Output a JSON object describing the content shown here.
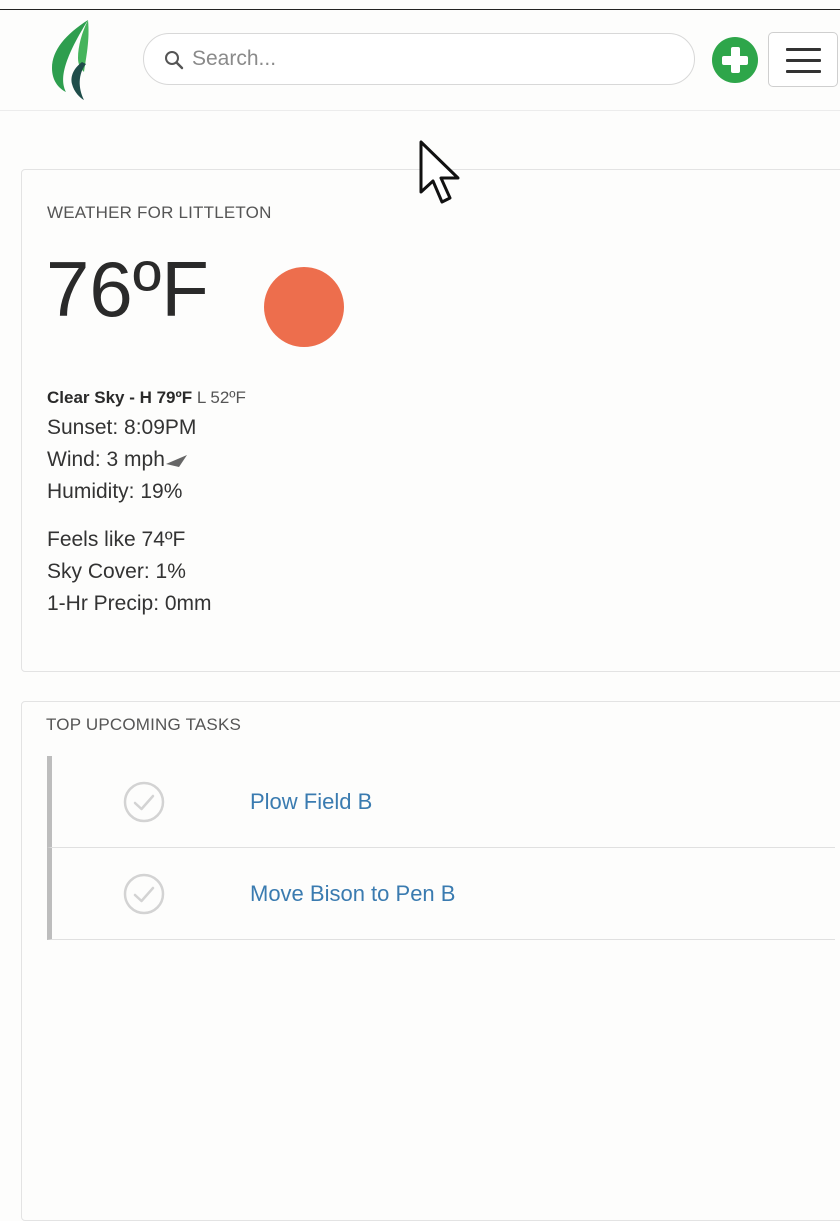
{
  "header": {
    "search_placeholder": "Search..."
  },
  "weather": {
    "title": "WEATHER FOR LITTLETON",
    "temperature": "76ºF",
    "condition": "Clear Sky - H 79ºF",
    "low": "L 52ºF",
    "sunset": "Sunset: 8:09PM",
    "wind": "Wind: 3 mph",
    "humidity": "Humidity: 19%",
    "feels_like": "Feels like 74ºF",
    "sky_cover": "Sky Cover: 1%",
    "precip": "1-Hr Precip: 0mm",
    "sun_color": "#ed6e4d"
  },
  "tasks": {
    "title": "TOP UPCOMING TASKS",
    "items": [
      {
        "label": "Plow Field B"
      },
      {
        "label": "Move Bison to Pen B"
      }
    ]
  },
  "colors": {
    "brand_green": "#2ea64a",
    "link_blue": "#3a7bb0"
  },
  "icons": {
    "logo": "leaf-logo",
    "search": "search-icon",
    "add": "plus-circle-icon",
    "menu": "hamburger-icon",
    "wind": "wind-direction-arrow-icon",
    "task": "check-circle-icon"
  }
}
